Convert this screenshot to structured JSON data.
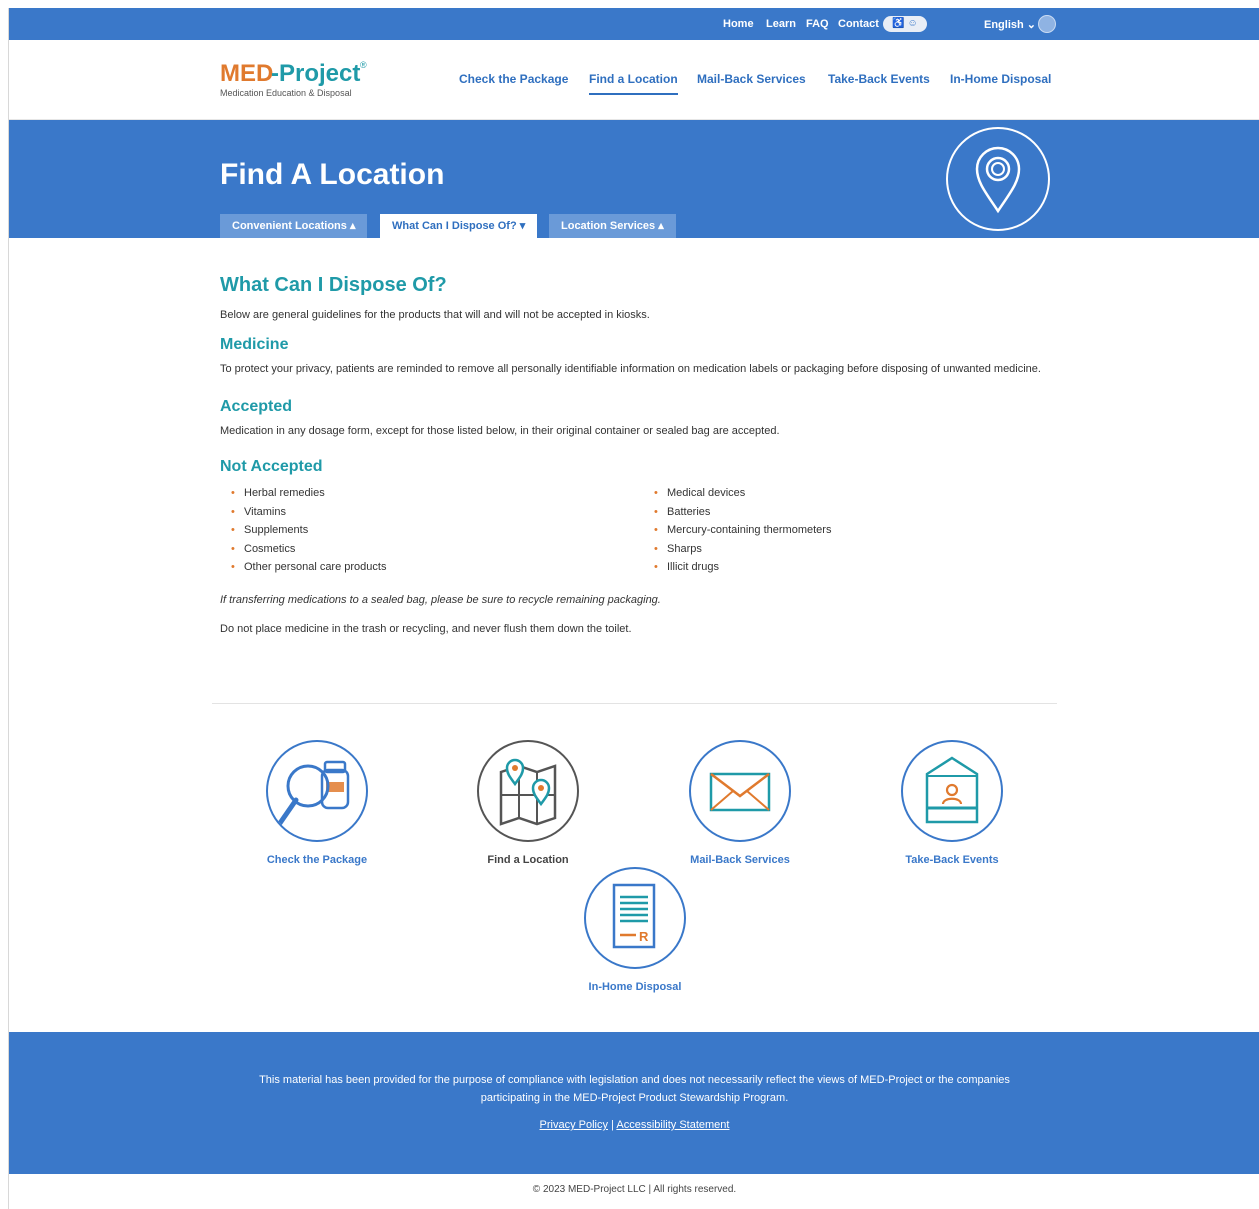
{
  "utility_bar": {
    "links": [
      "Home",
      "Learn",
      "FAQ",
      "Contact"
    ],
    "language": "English",
    "accessibility_label": "♿ ☺"
  },
  "header": {
    "logo_main_a": "MED",
    "logo_main_b": "-Project",
    "logo_sup": "®",
    "logo_sub": "Medication Education & Disposal",
    "nav": [
      "Check the Package",
      "Find a Location",
      "Mail-Back Services",
      "Take-Back Events",
      "In-Home Disposal"
    ],
    "active_nav": "Find a Location"
  },
  "banner": {
    "title": "Find A Location",
    "tabs": [
      "Convenient Locations ▴",
      "What Can I Dispose Of? ▾",
      "Location Services ▴"
    ]
  },
  "content": {
    "heading": "What Can I Dispose Of?",
    "intro": "Below are general guidelines for the products that will and will not be accepted in kiosks.",
    "medicine_heading": "Medicine",
    "medicine_text": "To protect your privacy, patients are reminded to remove all personally identifiable information on medication labels or packaging before disposing of unwanted medicine.",
    "accepted_heading": "Accepted",
    "accepted_text": "Medication in any dosage form, except for those listed below, in their original container or sealed bag are accepted.",
    "not_accepted_heading": "Not Accepted",
    "not_accepted_left": [
      "Herbal remedies",
      "Vitamins",
      "Supplements",
      "Cosmetics",
      "Other personal care products"
    ],
    "not_accepted_right": [
      "Medical devices",
      "Batteries",
      "Mercury-containing thermometers",
      "Sharps",
      "Illicit drugs"
    ],
    "note_italic": "If transferring medications to a sealed bag, please be sure to recycle remaining packaging.",
    "note_trash": "Do not place medicine in the trash or recycling, and never flush them down the toilet."
  },
  "cards": [
    "Check the Package",
    "Find a Location",
    "Mail-Back Services",
    "Take-Back Events",
    "In-Home Disposal"
  ],
  "footer": {
    "disclaimer": "This material has been provided for the purpose of compliance with legislation and does not necessarily reflect the views of MED-Project or the companies participating in the MED-Project Product Stewardship Program.",
    "privacy": "Privacy Policy",
    "separator": "|",
    "accessibility": "Accessibility Statement",
    "copyright": "© 2023 MED-Project LLC | All rights reserved."
  },
  "colors": {
    "brand_blue": "#3a78c9",
    "brand_teal": "#1f9aa8",
    "brand_orange": "#e07a2e"
  }
}
